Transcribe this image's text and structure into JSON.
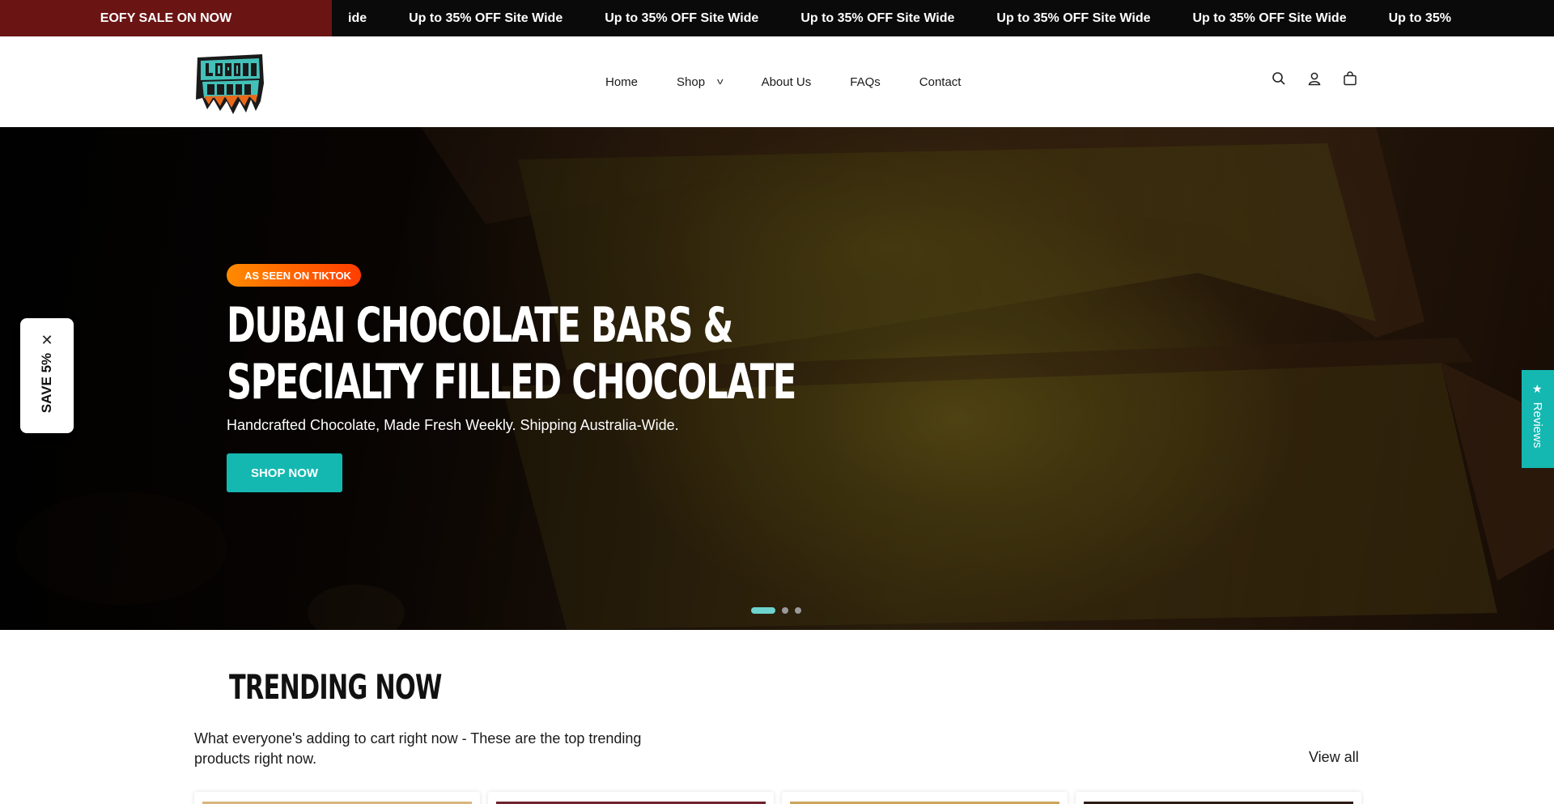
{
  "announcement": {
    "sale_label": "EOFY SALE ON NOW",
    "partial_item": "ide",
    "items": [
      "Up to 35% OFF Site Wide",
      "Up to 35% OFF Site Wide",
      "Up to 35% OFF Site Wide",
      "Up to 35% OFF Site Wide",
      "Up to 35% OFF Site Wide",
      "Up to 35%"
    ]
  },
  "header": {
    "logo_text": "LOADED STUFF",
    "nav": [
      "Home",
      "Shop",
      "About Us",
      "FAQs",
      "Contact"
    ],
    "icons": [
      "search-icon",
      "account-icon",
      "cart-icon"
    ]
  },
  "hero": {
    "badge": "AS SEEN ON TIKTOK",
    "title_line1": "DUBAI CHOCOLATE BARS &",
    "title_line2": "SPECIALTY FILLED CHOCOLATE",
    "subtitle": "Handcrafted Chocolate, Made Fresh Weekly. Shipping Australia-Wide.",
    "cta": "SHOP NOW",
    "slides": 3,
    "active_slide": 1
  },
  "widgets": {
    "save_label": "SAVE 5%",
    "reviews_label": "Reviews"
  },
  "trending": {
    "title": "TRENDING NOW",
    "description": "What everyone's adding to cart right now - These are the top trending products right now.",
    "view_all": "View all"
  },
  "colors": {
    "accent": "#14b8b1",
    "sale_bg": "#6b1414",
    "badge_start": "#ff8a00",
    "badge_end": "#ff3d00"
  }
}
